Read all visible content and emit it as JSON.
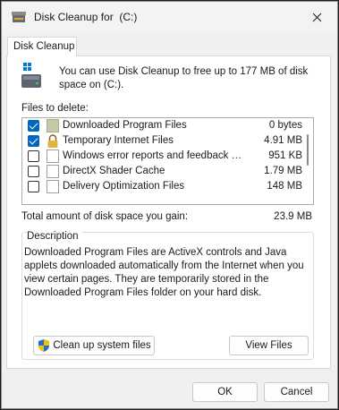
{
  "window": {
    "title": "Disk Cleanup for  (C:)",
    "title_icon": "disk-cleanup-icon",
    "close_icon": "close-icon"
  },
  "tabs": [
    {
      "label": "Disk Cleanup"
    }
  ],
  "intro": {
    "text": "You can use Disk Cleanup to free up to 177 MB of disk space on  (C:).",
    "icon": "drive-icon"
  },
  "files_label": "Files to delete:",
  "files": [
    {
      "name": "Downloaded Program Files",
      "size": "0 bytes",
      "checked": true,
      "icon": "folder-icon"
    },
    {
      "name": "Temporary Internet Files",
      "size": "4.91 MB",
      "checked": true,
      "icon": "lock-icon"
    },
    {
      "name": "Windows error reports and feedback di...",
      "size": "951 KB",
      "checked": false,
      "icon": "file-icon"
    },
    {
      "name": "DirectX Shader Cache",
      "size": "1.79 MB",
      "checked": false,
      "icon": "file-icon"
    },
    {
      "name": "Delivery Optimization Files",
      "size": "148 MB",
      "checked": false,
      "icon": "file-icon"
    }
  ],
  "total": {
    "label": "Total amount of disk space you gain:",
    "value": "23.9 MB"
  },
  "description": {
    "title": "Description",
    "text": "Downloaded Program Files are ActiveX controls and Java applets downloaded automatically from the Internet when you view certain pages. They are temporarily stored in the Downloaded Program Files folder on your hard disk."
  },
  "buttons": {
    "cleanup_system": "Clean up system files",
    "view_files": "View Files",
    "ok": "OK",
    "cancel": "Cancel"
  },
  "colors": {
    "accent": "#0067c0"
  }
}
